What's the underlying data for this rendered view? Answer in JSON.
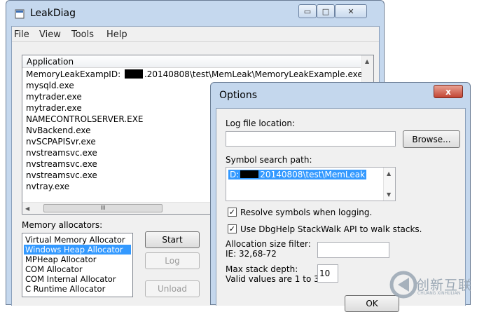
{
  "main_window": {
    "title": "LeakDiag",
    "menu": [
      "File",
      "View",
      "Tools",
      "Help"
    ],
    "applications_header": "Application",
    "applications": [
      {
        "prefix": "MemoryLeakExampID: ",
        "suffix": ".20140808\\test\\MemLeak\\MemoryLeakExample.exe"
      },
      {
        "prefix": "mysqld.exe",
        "suffix": ""
      },
      {
        "prefix": "mytrader.exe",
        "suffix": ""
      },
      {
        "prefix": "mytrader.exe",
        "suffix": ""
      },
      {
        "prefix": "NAMECONTROLSERVER.EXE",
        "suffix": ""
      },
      {
        "prefix": "NvBackend.exe",
        "suffix": ""
      },
      {
        "prefix": "nvSCPAPISvr.exe",
        "suffix": ""
      },
      {
        "prefix": "nvstreamsvc.exe",
        "suffix": ""
      },
      {
        "prefix": "nvstreamsvc.exe",
        "suffix": ""
      },
      {
        "prefix": "nvstreamsvc.exe",
        "suffix": ""
      },
      {
        "prefix": "nvtray.exe",
        "suffix": ""
      }
    ],
    "hscroll_thumb": "III",
    "memory_allocators_label": "Memory allocators:",
    "allocators": [
      "Virtual Memory Allocator",
      "Windows Heap Allocator",
      "MPHeap Allocator",
      "COM Allocator",
      "COM Internal Allocator",
      "C Runtime Allocator"
    ],
    "selected_allocator": 1,
    "buttons": {
      "start": "Start",
      "log": "Log",
      "unload": "Unload"
    }
  },
  "options_dialog": {
    "title": "Options",
    "close_glyph": "x",
    "log_file_location_label": "Log file location:",
    "log_file_location_value": "",
    "browse_button": "Browse...",
    "symbol_search_path_label": "Symbol search path:",
    "symbol_search_path_prefix": "D:",
    "symbol_search_path_suffix": "20140808\\test\\MemLeak",
    "resolve_symbols_label": "Resolve symbols when logging.",
    "resolve_symbols_checked": true,
    "stackwalk_label": "Use DbgHelp StackWalk API to walk stacks.",
    "stackwalk_checked": true,
    "alloc_filter_label_1": "Allocation size filter:",
    "alloc_filter_label_2": "IE: 32,68-72",
    "alloc_filter_value": "",
    "max_stack_label_1": "Max stack depth:",
    "max_stack_label_2": "Valid values are 1 to 32",
    "max_stack_value": "10",
    "ok_button": "OK"
  },
  "watermark": {
    "text": "创新互联",
    "sub": "CHUANG XINHULIAN"
  },
  "colors": {
    "selection": "#3399ff",
    "window_frame": "#c5d8ee",
    "close_button": "#c24433"
  }
}
